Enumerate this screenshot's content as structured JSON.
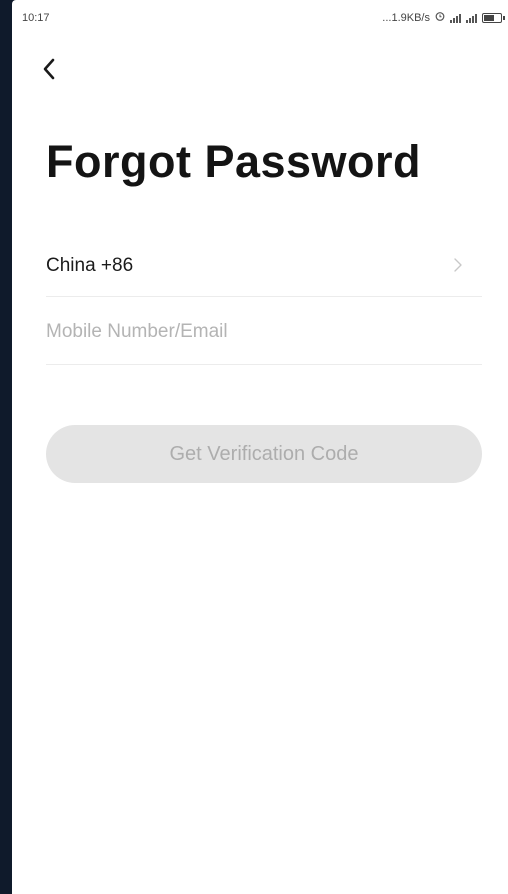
{
  "status_bar": {
    "time": "10:17",
    "network_speed": "...1.9KB/s"
  },
  "page": {
    "title": "Forgot Password"
  },
  "country_selector": {
    "label": "China +86"
  },
  "account_input": {
    "value": "",
    "placeholder": "Mobile Number/Email"
  },
  "actions": {
    "verify_label": "Get Verification Code"
  },
  "colors": {
    "background_frame": "#0f1a2b",
    "screen": "#ffffff",
    "button_disabled_bg": "#e4e4e4",
    "button_disabled_text": "#adadad",
    "divider": "#ececec"
  }
}
